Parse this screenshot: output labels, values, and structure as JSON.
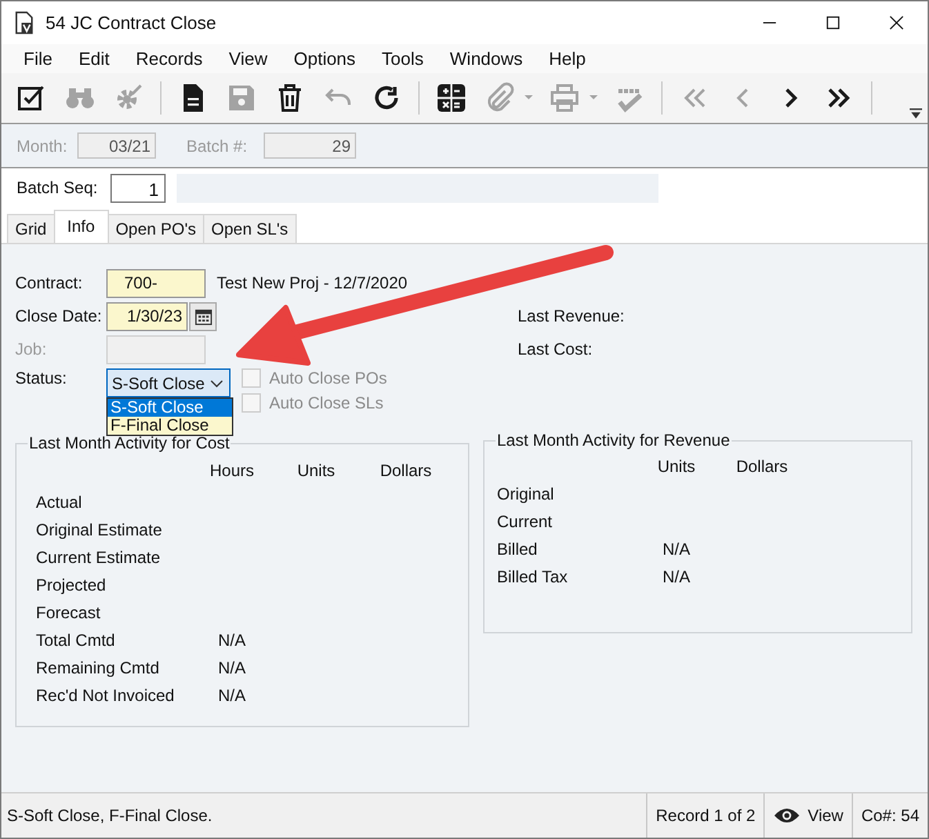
{
  "window": {
    "title": "54 JC Contract Close"
  },
  "menu": [
    "File",
    "Edit",
    "Records",
    "View",
    "Options",
    "Tools",
    "Windows",
    "Help"
  ],
  "toolbar": [
    {
      "kind": "edit",
      "disabled": false
    },
    {
      "kind": "find",
      "disabled": true
    },
    {
      "kind": "wizard",
      "disabled": true
    },
    {
      "kind": "separator"
    },
    {
      "kind": "new",
      "disabled": false
    },
    {
      "kind": "save",
      "disabled": true
    },
    {
      "kind": "delete",
      "disabled": false
    },
    {
      "kind": "undo",
      "disabled": true
    },
    {
      "kind": "refresh",
      "disabled": false
    },
    {
      "kind": "separator"
    },
    {
      "kind": "calculator",
      "disabled": false
    },
    {
      "kind": "attach",
      "disabled": true,
      "dropdown": true
    },
    {
      "kind": "print",
      "disabled": true,
      "dropdown": true
    },
    {
      "kind": "spellcheck",
      "disabled": true
    },
    {
      "kind": "separator"
    },
    {
      "kind": "first",
      "disabled": true
    },
    {
      "kind": "prev",
      "disabled": true
    },
    {
      "kind": "next",
      "disabled": false
    },
    {
      "kind": "last",
      "disabled": false
    },
    {
      "kind": "separator"
    }
  ],
  "header": {
    "month": {
      "label": "Month:",
      "value": "03/21",
      "disabled": true
    },
    "batch": {
      "label": "Batch #:",
      "value": "29",
      "disabled": true
    }
  },
  "batch_seq": {
    "label": "Batch Seq:",
    "value": "1"
  },
  "tabs": [
    {
      "label": "Grid",
      "selected": false
    },
    {
      "label": "Info",
      "selected": true
    },
    {
      "label": "Open PO's",
      "selected": false
    },
    {
      "label": "Open SL's",
      "selected": false
    }
  ],
  "form": {
    "contract": {
      "label": "Contract:",
      "value": "700-",
      "description": "Test New Proj - 12/7/2020"
    },
    "close_date": {
      "label": "Close Date:",
      "value": "1/30/23"
    },
    "job": {
      "label": "Job:",
      "disabled": true
    },
    "status": {
      "label": "Status:",
      "value": "S-Soft Close",
      "expanded": true,
      "options": [
        {
          "label": "S-Soft Close",
          "selected": true
        },
        {
          "label": "F-Final Close",
          "selected": false
        }
      ]
    },
    "checkboxes": [
      {
        "label": "Auto Close POs",
        "checked": false,
        "disabled": true
      },
      {
        "label": "Auto Close SLs",
        "checked": false,
        "disabled": true
      }
    ],
    "last_revenue": {
      "label": "Last Revenue:"
    },
    "last_cost": {
      "label": "Last Cost:"
    }
  },
  "cost_group": {
    "title": "Last Month Activity for Cost",
    "columns": [
      "Hours",
      "Units",
      "Dollars"
    ],
    "rows": [
      {
        "label": "Actual"
      },
      {
        "label": "Original Estimate"
      },
      {
        "label": "Current Estimate"
      },
      {
        "label": "Projected"
      },
      {
        "label": "Forecast"
      },
      {
        "label": "Total Cmtd",
        "hours": "N/A"
      },
      {
        "label": "Remaining Cmtd",
        "hours": "N/A"
      },
      {
        "label": "Rec'd Not Invoiced",
        "hours": "N/A"
      }
    ]
  },
  "revenue_group": {
    "title": "Last Month Activity for Revenue",
    "columns": [
      "Units",
      "Dollars"
    ],
    "rows": [
      {
        "label": "Original"
      },
      {
        "label": "Current"
      },
      {
        "label": "Billed",
        "units": "N/A"
      },
      {
        "label": "Billed Tax",
        "units": "N/A"
      }
    ]
  },
  "status_bar": {
    "message": "S-Soft Close, F-Final Close.",
    "record": "Record 1 of 2",
    "mode": "View",
    "company": "Co#: 54"
  }
}
